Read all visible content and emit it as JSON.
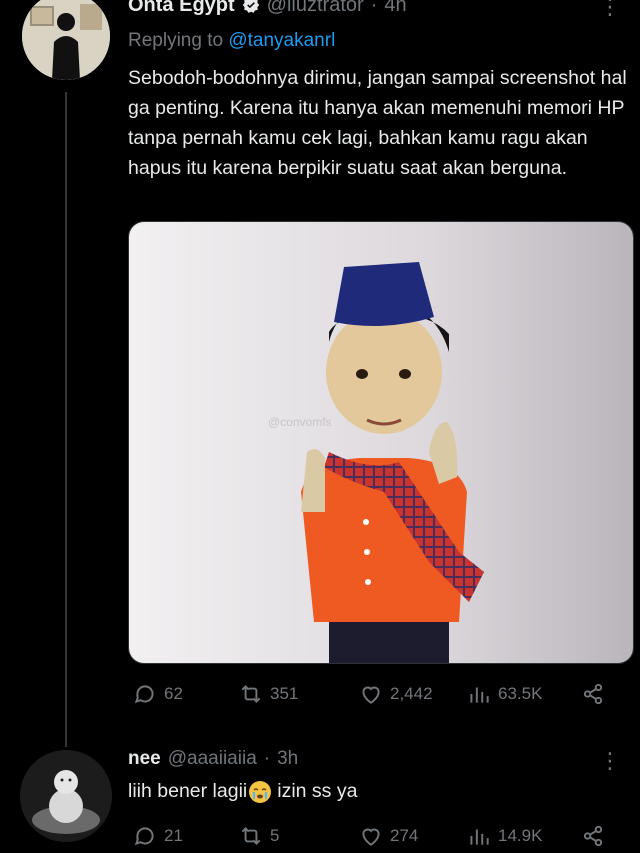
{
  "tweet": {
    "name": "Onta Egypt",
    "handle": "@iluztrator",
    "time": "4h",
    "replying_prefix": "Replying to",
    "replying_to": "@tanyakanrl",
    "text": "Sebodoh-bodohnya dirimu, jangan sampai screenshot hal ga penting. Karena itu hanya akan memenuhi memori HP tanpa pernah kamu cek lagi, bahkan kamu ragu akan hapus itu karena berpikir suatu saat akan berguna.",
    "media_watermark": "@convomfs",
    "stats": {
      "replies": "62",
      "retweets": "351",
      "likes": "2,442",
      "views": "63.5K"
    }
  },
  "reply": {
    "name": "nee",
    "handle": "@aaaiiaiia",
    "time": "3h",
    "text_before": "liih bener lagii",
    "text_after": "izin ss ya",
    "stats": {
      "replies": "21",
      "retweets": "5",
      "likes": "274",
      "views": "14.9K"
    }
  },
  "separator": "·",
  "more_glyph": "⋮",
  "icons": [
    "verified-icon",
    "reply-icon",
    "retweet-icon",
    "like-icon",
    "views-icon",
    "share-icon",
    "crying-emoji",
    "more-icon"
  ],
  "colors": {
    "background": "#000000",
    "text": "#e7e9ea",
    "muted": "#71767b",
    "link": "#1d9bf0"
  }
}
